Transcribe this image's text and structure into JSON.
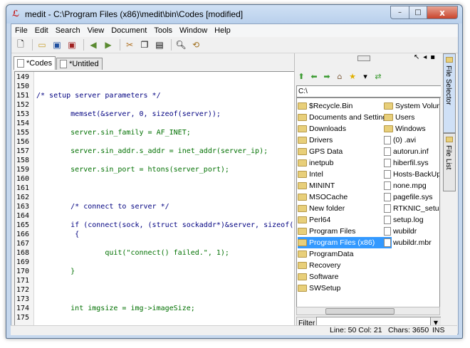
{
  "window": {
    "title": "medit - C:\\Program Files (x86)\\medit\\bin\\Codes [modified]",
    "controls": {
      "min": "–",
      "max": "□",
      "close": "x"
    }
  },
  "menu": [
    "File",
    "Edit",
    "Search",
    "View",
    "Document",
    "Tools",
    "Window",
    "Help"
  ],
  "toolbar": [
    "new-icon",
    "open-icon",
    "save-icon",
    "save-as-icon",
    "undo-icon",
    "redo-icon",
    "cut-icon",
    "copy-icon",
    "paste-icon",
    "find-icon",
    "find-replace-icon"
  ],
  "tabs": [
    {
      "label": "*Codes",
      "active": true
    },
    {
      "label": "*Untitled",
      "active": false
    }
  ],
  "code": [
    {
      "n": "149",
      "t": ""
    },
    {
      "n": "150",
      "t": ""
    },
    {
      "n": "151",
      "t": "/* setup server parameters */"
    },
    {
      "n": "152",
      "t": ""
    },
    {
      "n": "153",
      "t": "        memset(&server, 0, sizeof(server));"
    },
    {
      "n": "154",
      "t": ""
    },
    {
      "n": "155",
      "t": "        server.sin_family = AF_INET;"
    },
    {
      "n": "156",
      "t": ""
    },
    {
      "n": "157",
      "t": "        server.sin_addr.s_addr = inet_addr(server_ip);"
    },
    {
      "n": "158",
      "t": ""
    },
    {
      "n": "159",
      "t": "        server.sin_port = htons(server_port);"
    },
    {
      "n": "160",
      "t": ""
    },
    {
      "n": "161",
      "t": ""
    },
    {
      "n": "162",
      "t": ""
    },
    {
      "n": "163",
      "t": "        /* connect to server */"
    },
    {
      "n": "164",
      "t": ""
    },
    {
      "n": "165",
      "t": "        if (connect(sock, (struct sockaddr*)&server, sizeof("
    },
    {
      "n": "166",
      "t": "         {"
    },
    {
      "n": "167",
      "t": ""
    },
    {
      "n": "168",
      "t": "                quit(\"connect() failed.\", 1);"
    },
    {
      "n": "169",
      "t": ""
    },
    {
      "n": "170",
      "t": "        }"
    },
    {
      "n": "171",
      "t": ""
    },
    {
      "n": "172",
      "t": ""
    },
    {
      "n": "173",
      "t": ""
    },
    {
      "n": "174",
      "t": "        int imgsize = img->imageSize;"
    },
    {
      "n": "175",
      "t": ""
    }
  ],
  "selector": {
    "path": "C:\\",
    "col1": [
      {
        "name": "$Recycle.Bin",
        "kind": "folder"
      },
      {
        "name": "Documents and Settings",
        "kind": "folder"
      },
      {
        "name": "Downloads",
        "kind": "folder"
      },
      {
        "name": "Drivers",
        "kind": "folder"
      },
      {
        "name": "GPS Data",
        "kind": "folder"
      },
      {
        "name": "inetpub",
        "kind": "folder"
      },
      {
        "name": "Intel",
        "kind": "folder"
      },
      {
        "name": "MININT",
        "kind": "folder"
      },
      {
        "name": "MSOCache",
        "kind": "folder"
      },
      {
        "name": "New folder",
        "kind": "folder"
      },
      {
        "name": "Perl64",
        "kind": "folder"
      },
      {
        "name": "Program Files",
        "kind": "folder"
      },
      {
        "name": "Program Files (x86)",
        "kind": "folder",
        "selected": true
      },
      {
        "name": "ProgramData",
        "kind": "folder"
      },
      {
        "name": "Recovery",
        "kind": "folder"
      },
      {
        "name": "Software",
        "kind": "folder"
      },
      {
        "name": "SWSetup",
        "kind": "folder"
      }
    ],
    "col2": [
      {
        "name": "System Volume",
        "kind": "folder"
      },
      {
        "name": "Users",
        "kind": "folder"
      },
      {
        "name": "Windows",
        "kind": "folder"
      },
      {
        "name": "(0) .avi",
        "kind": "file"
      },
      {
        "name": "autorun.inf",
        "kind": "file"
      },
      {
        "name": "hiberfil.sys",
        "kind": "file"
      },
      {
        "name": "Hosts-BackUp",
        "kind": "file"
      },
      {
        "name": "none.mpg",
        "kind": "file"
      },
      {
        "name": "pagefile.sys",
        "kind": "file"
      },
      {
        "name": "RTKNIC_setup.lo",
        "kind": "file"
      },
      {
        "name": "setup.log",
        "kind": "file"
      },
      {
        "name": "wubildr",
        "kind": "file"
      },
      {
        "name": "wubildr.mbr",
        "kind": "file"
      }
    ],
    "filter_label": "Filter"
  },
  "side_tabs": [
    "File Selector",
    "File List"
  ],
  "status": {
    "line": "Line: 50 Col: 21",
    "chars": "Chars: 3650",
    "mode": "INS"
  }
}
